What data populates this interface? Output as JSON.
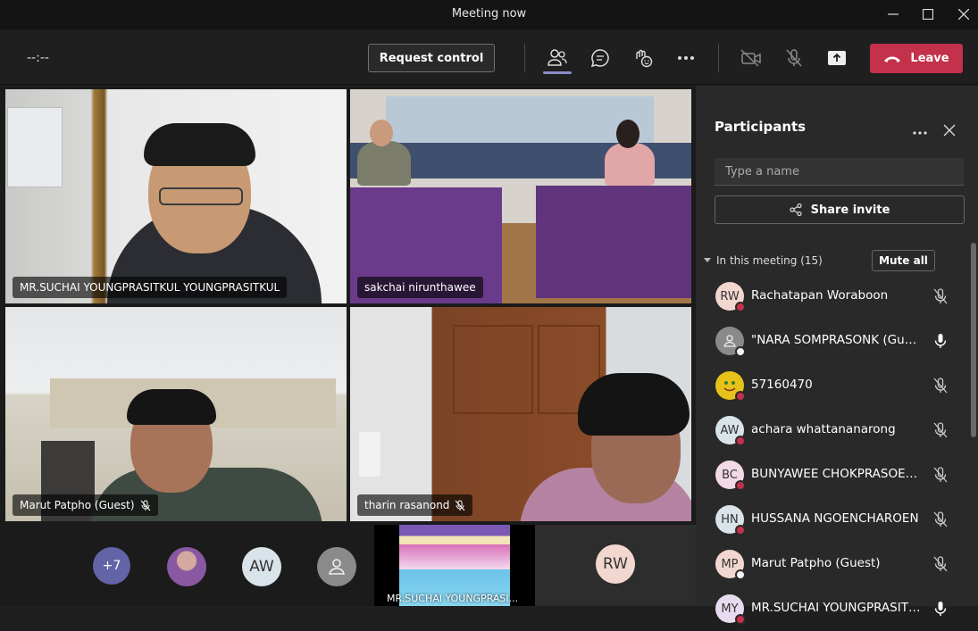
{
  "window": {
    "title": "Meeting now"
  },
  "toolbar": {
    "timer": "--:--",
    "request_control": "Request control",
    "leave": "Leave",
    "icons": [
      "participants-icon",
      "chat-icon",
      "reactions-icon",
      "more-icon",
      "camera-off-icon",
      "mic-off-icon",
      "share-tray-icon",
      "phone-icon"
    ]
  },
  "video_tiles": [
    {
      "name": "MR.SUCHAI YOUNGPRASITKUL YOUNGPRASITKUL",
      "muted": false
    },
    {
      "name": "sakchai nirunthawee",
      "muted": false
    },
    {
      "name": "Marut Patpho (Guest)",
      "muted": true
    },
    {
      "name": "tharin rasanond",
      "muted": true
    }
  ],
  "overflow": {
    "more_count": "+7",
    "avatars": [
      "AW",
      "RW"
    ],
    "shared_tile_name": "MR.SUCHAI YOUNGPRASI..."
  },
  "participants_panel": {
    "title": "Participants",
    "search_placeholder": "Type a name",
    "share_invite": "Share invite",
    "in_meeting_label": "In this meeting (15)",
    "mute_all": "Mute all",
    "list": [
      {
        "initials": "RW",
        "name": "Rachatapan Woraboon",
        "mic": "off",
        "status": "red",
        "bg": "#f1d7cf"
      },
      {
        "initials": "",
        "name": "\"NARA SOMPRASONK (Guest)\"",
        "mic": "on",
        "status": "white",
        "bg": "#8a8a8a"
      },
      {
        "initials": "",
        "name": "57160470",
        "mic": "off",
        "status": "red",
        "bg": "#e6c21a"
      },
      {
        "initials": "AW",
        "name": "achara whattananarong",
        "mic": "off",
        "status": "red",
        "bg": "#d9e3ea"
      },
      {
        "initials": "BC",
        "name": "BUNYAWEE CHOKPRASOETS...",
        "mic": "off",
        "status": "red",
        "bg": "#f2d9e6"
      },
      {
        "initials": "HN",
        "name": "HUSSANA NGOENCHAROEN",
        "mic": "off",
        "status": "red",
        "bg": "#d9e3ea"
      },
      {
        "initials": "MP",
        "name": "Marut Patpho (Guest)",
        "mic": "off",
        "status": "white",
        "bg": "#f1d7cf"
      },
      {
        "initials": "MY",
        "name": "MR.SUCHAI YOUNGPRASITK...",
        "mic": "on",
        "status": "red",
        "bg": "#e7dbef"
      }
    ]
  },
  "colors": {
    "leave": "#c4314b",
    "accent": "#8b8cc7",
    "panel_bg": "#292929",
    "stage_bg": "#1b1b1b"
  }
}
